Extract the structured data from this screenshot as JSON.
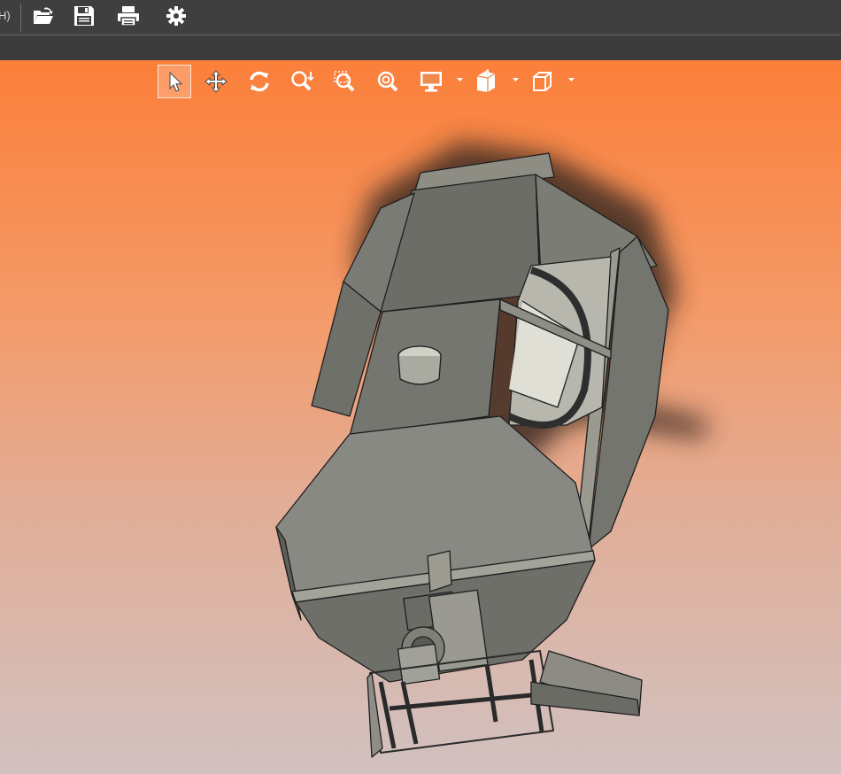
{
  "app": {
    "top_left_fragment": "H)"
  },
  "toolbar": {
    "items": [
      {
        "name": "open-folder",
        "icon": "folder-open-icon"
      },
      {
        "name": "save",
        "icon": "save-icon"
      },
      {
        "name": "print",
        "icon": "print-icon"
      },
      {
        "name": "settings",
        "icon": "gear-icon"
      }
    ]
  },
  "view_toolbar": {
    "active_tool": "select",
    "tools": [
      {
        "name": "select",
        "icon": "cursor-arrow-icon"
      },
      {
        "name": "pan",
        "icon": "move-arrows-icon"
      },
      {
        "name": "rotate",
        "icon": "rotate-icon"
      },
      {
        "name": "zoom",
        "icon": "zoom-icon"
      },
      {
        "name": "zoom-window",
        "icon": "zoom-window-icon"
      },
      {
        "name": "zoom-fit",
        "icon": "zoom-fit-icon"
      },
      {
        "name": "display-mode",
        "icon": "monitor-icon",
        "dropdown": true
      },
      {
        "name": "section-view",
        "icon": "section-cube-icon",
        "dropdown": true
      },
      {
        "name": "view-orientation",
        "icon": "cube-icon",
        "dropdown": true
      }
    ]
  },
  "colors": {
    "toolbar_bg": "#3f3f3f",
    "viewport_top": "#fb7f3a",
    "viewport_bottom": "#d1c1c0",
    "model_face": "#8a8a80",
    "model_edge": "#1e1e1e"
  }
}
